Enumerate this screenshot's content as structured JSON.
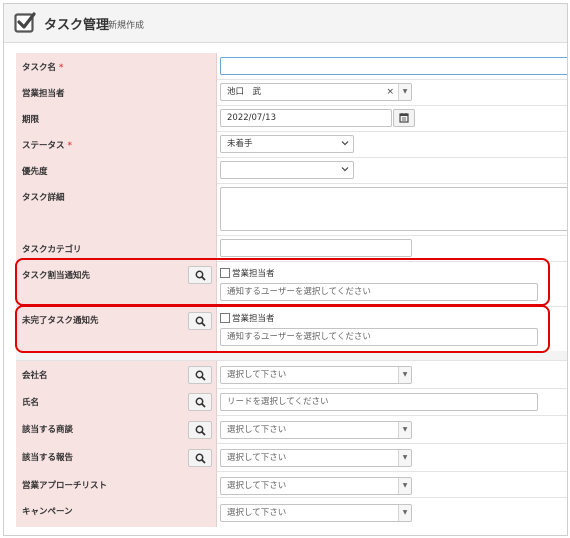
{
  "header": {
    "title": "タスク管理",
    "subtitle": "新規作成"
  },
  "fields": {
    "task_name": {
      "label": "タスク名",
      "required_mark": "*",
      "value": ""
    },
    "sales_rep": {
      "label": "営業担当者",
      "value": "池口　武",
      "clear": "×",
      "arrow": "▼"
    },
    "deadline": {
      "label": "期限",
      "value": "2022/07/13"
    },
    "status": {
      "label": "ステータス",
      "required_mark": "*",
      "value": "未着手"
    },
    "priority": {
      "label": "優先度",
      "value": ""
    },
    "detail": {
      "label": "タスク詳細",
      "value": ""
    },
    "category": {
      "label": "タスクカテゴリ",
      "value": ""
    },
    "assign_notify": {
      "label": "タスク割当通知先",
      "checkbox_label": "営業担当者",
      "placeholder": "通知するユーザーを選択してください"
    },
    "incomplete_notify": {
      "label": "未完了タスク通知先",
      "checkbox_label": "営業担当者",
      "placeholder": "通知するユーザーを選択してください"
    },
    "company": {
      "label": "会社名",
      "placeholder": "選択して下さい",
      "arrow": "▼"
    },
    "name": {
      "label": "氏名",
      "placeholder": "リードを選択してください"
    },
    "deal": {
      "label": "該当する商談",
      "placeholder": "選択して下さい",
      "arrow": "▼"
    },
    "report": {
      "label": "該当する報告",
      "placeholder": "選択して下さい",
      "arrow": "▼"
    },
    "approach_list": {
      "label": "営業アプローチリスト",
      "placeholder": "選択して下さい",
      "arrow": "▼"
    },
    "campaign": {
      "label": "キャンペーン",
      "placeholder": "選択して下さい",
      "arrow": "▼"
    }
  },
  "colors": {
    "label_bg": "#f8e3e3",
    "highlight": "#e00000",
    "required": "#d9534f"
  },
  "icons": [
    "checkbox-check-icon",
    "calendar-icon",
    "chevron-down-icon",
    "search-icon"
  ]
}
